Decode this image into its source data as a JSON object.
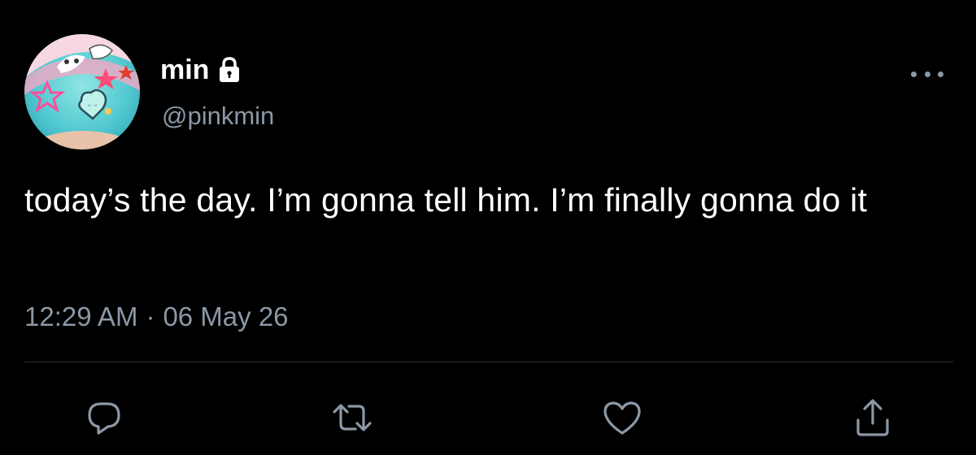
{
  "author": {
    "display_name": "min",
    "handle": "@pinkmin",
    "avatar_icon": "avatar-image",
    "protected_icon": "lock-icon"
  },
  "tweet": {
    "text": "today’s the day. I’m gonna tell him. I’m finally gonna do it",
    "time": "12:29 AM",
    "separator": "·",
    "date": "06 May 26"
  },
  "actions": {
    "reply_icon": "reply-icon",
    "retweet_icon": "retweet-icon",
    "like_icon": "heart-icon",
    "share_icon": "share-icon",
    "more_icon": "more-icon"
  },
  "colors": {
    "background": "#000000",
    "primary_text": "#ffffff",
    "secondary_text": "#8b98a5",
    "divider": "#2f3336"
  }
}
